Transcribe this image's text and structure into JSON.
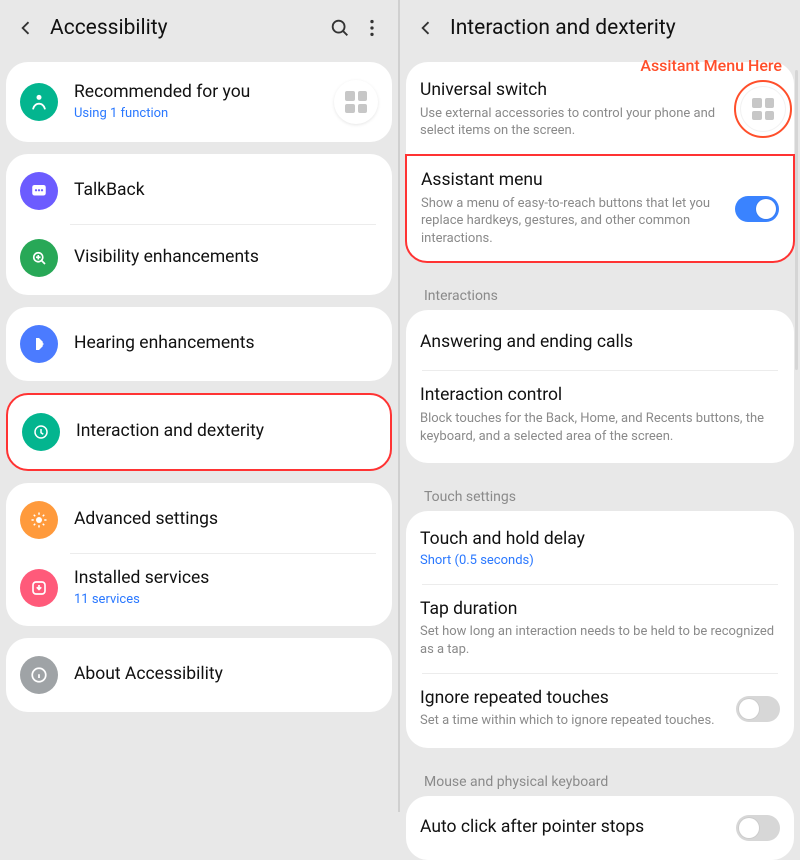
{
  "annotation": {
    "label": "Assitant Menu Here"
  },
  "left": {
    "header": {
      "title": "Accessibility"
    },
    "recommended": {
      "title": "Recommended for you",
      "sub": "Using 1 function",
      "fab_icon": "grid-icon"
    },
    "group1": [
      {
        "icon": "talkback-icon",
        "color": "bg-purple",
        "title": "TalkBack"
      },
      {
        "icon": "visibility-icon",
        "color": "bg-green",
        "title": "Visibility enhancements"
      }
    ],
    "group2": [
      {
        "icon": "hearing-icon",
        "color": "bg-blue",
        "title": "Hearing enhancements"
      }
    ],
    "group3": [
      {
        "icon": "interaction-icon",
        "color": "bg-teal",
        "title": "Interaction and dexterity",
        "highlight": true
      }
    ],
    "group4": [
      {
        "icon": "advanced-icon",
        "color": "bg-orange",
        "title": "Advanced settings"
      },
      {
        "icon": "installed-icon",
        "color": "bg-pink",
        "title": "Installed services",
        "sub": "11 services"
      }
    ],
    "group5": [
      {
        "icon": "info-icon",
        "color": "bg-gray",
        "title": "About Accessibility"
      }
    ]
  },
  "right": {
    "header": {
      "title": "Interaction and dexterity"
    },
    "top": [
      {
        "title": "Universal switch",
        "desc": "Use external accessories to control your phone and select items on the screen."
      },
      {
        "title": "Assistant menu",
        "desc": "Show a menu of easy-to-reach buttons that let you replace hardkeys, gestures, and other common interactions.",
        "toggle": true,
        "toggle_on": true,
        "highlight": true
      }
    ],
    "sections": [
      {
        "label": "Interactions",
        "items": [
          {
            "title": "Answering and ending calls"
          },
          {
            "title": "Interaction control",
            "desc": "Block touches for the Back, Home, and Recents buttons, the keyboard, and a selected area of the screen."
          }
        ]
      },
      {
        "label": "Touch settings",
        "items": [
          {
            "title": "Touch and hold delay",
            "sub": "Short (0.5 seconds)",
            "sub_blue": true
          },
          {
            "title": "Tap duration",
            "desc": "Set how long an interaction needs to be held to be recognized as a tap."
          },
          {
            "title": "Ignore repeated touches",
            "desc": "Set a time within which to ignore repeated touches.",
            "toggle": true,
            "toggle_on": false
          }
        ]
      },
      {
        "label": "Mouse and physical keyboard",
        "items": [
          {
            "title": "Auto click after pointer stops",
            "toggle": true,
            "toggle_on": false
          }
        ]
      }
    ]
  }
}
